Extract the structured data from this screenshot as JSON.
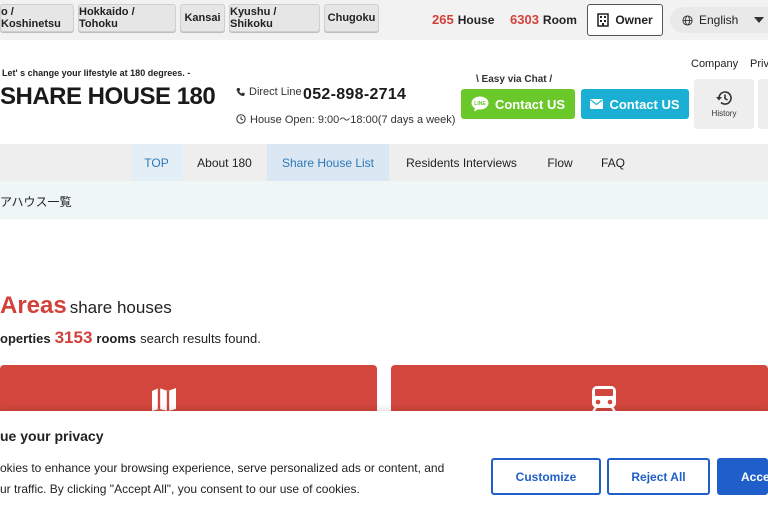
{
  "regions": [
    "o / Koshinetsu",
    "Hokkaido / Tohoku",
    "Kansai",
    "Kyushu / Shikoku",
    "Chugoku"
  ],
  "stats": {
    "house_count": "265",
    "house_label": "House",
    "room_count": "6303",
    "room_label": "Room"
  },
  "owner_label": "Owner",
  "language": "English",
  "header": {
    "tagline": "Let' s change your lifestyle at 180 degrees. -",
    "logo": "SHARE HOUSE 180",
    "direct_label": "Direct Line",
    "phone": "052-898-2714",
    "house_open": "House Open: 9:00～18:00(7 days a week)",
    "easy_chat": "\\ Easy via Chat /",
    "line_contact": "Contact US",
    "line_icon_text": "LINE",
    "mail_contact": "Contact US",
    "company": "Company",
    "privacy": "Priv",
    "history": "History"
  },
  "nav": [
    "TOP",
    "About 180",
    "Share House List",
    "Residents Interviews",
    "Flow",
    "FAQ"
  ],
  "breadcrumb": "アハウス一覧",
  "main": {
    "areas_title_big": "Areas",
    "areas_title_small": "share houses",
    "result_prefix": "operties",
    "rooms_count": "3153",
    "rooms_label": "rooms",
    "result_suffix": "search results found."
  },
  "cookie": {
    "title": "ue your privacy",
    "text_line1": "okies to enhance your browsing experience, serve personalized ads or content, and",
    "text_line2": "ur traffic. By clicking \"Accept All\", you consent to our use of cookies.",
    "customize": "Customize",
    "reject": "Reject All",
    "accept": "Acce"
  },
  "colors": {
    "accent_red": "#d2413a",
    "line_green": "#6ac82b",
    "mail_blue": "#1bb0d3",
    "cookie_blue": "#1f5fc9",
    "nav_active": "#2f78b7"
  }
}
